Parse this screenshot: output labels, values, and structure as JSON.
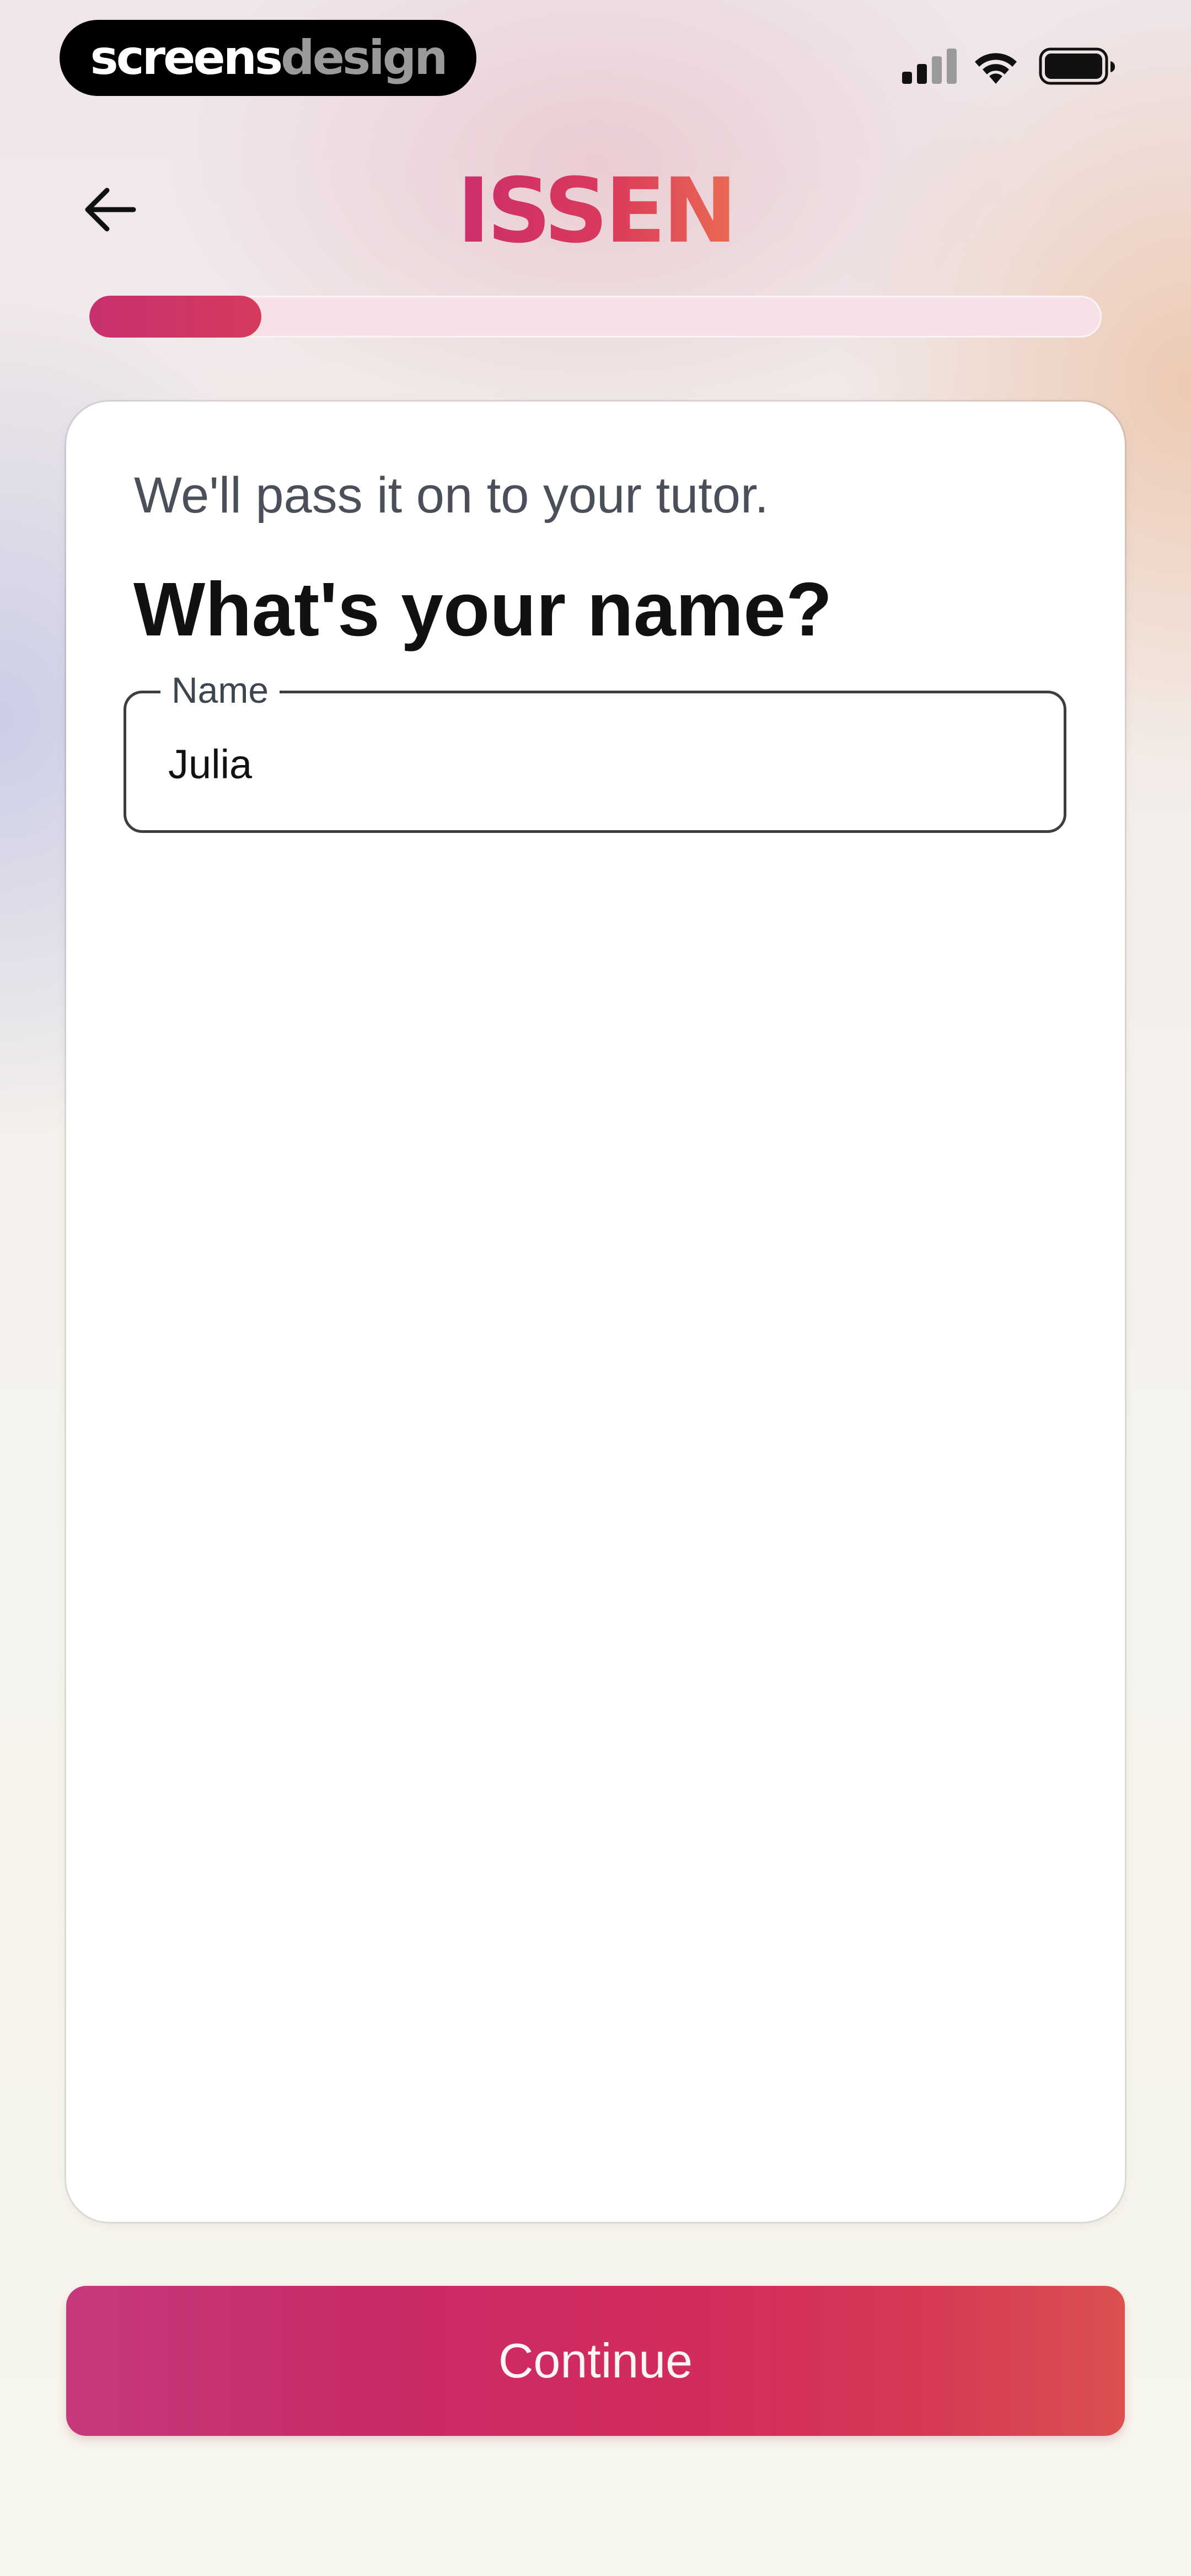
{
  "status_bar": {
    "brand_part1": "screens",
    "brand_part2": "design",
    "icons": [
      "cellular-signal-icon",
      "wifi-icon",
      "battery-icon"
    ]
  },
  "header": {
    "back_icon": "arrow-left-icon",
    "logo_text": "ISSEN"
  },
  "progress": {
    "fraction": 0.17
  },
  "form": {
    "subtitle": "We'll pass it on to your tutor.",
    "title": "What's your name?",
    "name_field": {
      "label": "Name",
      "value": "Julia"
    }
  },
  "actions": {
    "continue_label": "Continue"
  },
  "colors": {
    "accent": "#d02f62",
    "progress_track": "#f8e1e6",
    "card_background": "#ffffff"
  }
}
